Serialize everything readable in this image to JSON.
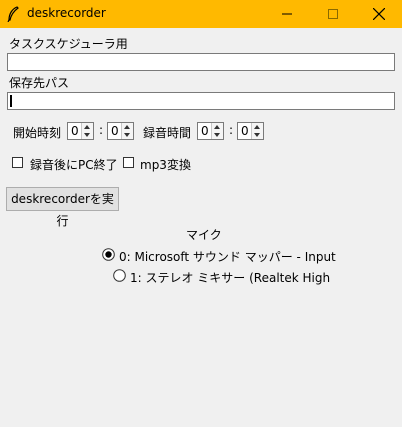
{
  "window": {
    "title": "deskrecorder",
    "icon": "feather-icon"
  },
  "form": {
    "scheduler_label": "タスクスケジューラ用",
    "scheduler_value": "",
    "save_path_label": "保存先パス",
    "save_path_value": "",
    "start_time_label": "開始時刻",
    "start_hour": "0",
    "start_minute": "0",
    "record_time_label": "録音時間",
    "record_hour": "0",
    "record_minute": "0",
    "time_separator": ":",
    "shutdown_label": "録音後にPC終了",
    "shutdown_checked": false,
    "mp3_label": "mp3変換",
    "mp3_checked": false,
    "run_button_label": "deskrecorderを実行"
  },
  "mic": {
    "heading": "マイク",
    "options": [
      {
        "label": "0: Microsoft サウンド マッパー - Input",
        "selected": true
      },
      {
        "label": "1: ステレオ ミキサー (Realtek High",
        "selected": false
      }
    ]
  },
  "colors": {
    "titlebar": "#ffb900",
    "background": "#f0f0f0"
  }
}
